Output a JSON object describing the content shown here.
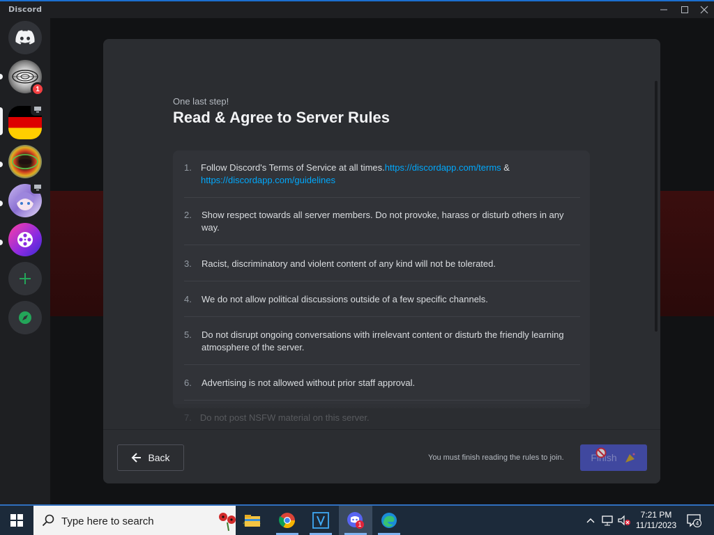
{
  "window": {
    "title": "Discord",
    "minimize": "—",
    "maximize": "☐",
    "close": "✕"
  },
  "sidebar": {
    "items": [
      {
        "name": "home",
        "icon": "discord-logo-icon"
      },
      {
        "name": "server-web",
        "badge": "1"
      },
      {
        "name": "server-germany",
        "selected": true
      },
      {
        "name": "server-colorful"
      },
      {
        "name": "server-anime"
      },
      {
        "name": "server-video"
      },
      {
        "name": "add-server",
        "icon": "plus-icon"
      },
      {
        "name": "explore",
        "icon": "compass-icon"
      }
    ]
  },
  "modal": {
    "eyebrow": "One last step!",
    "title": "Read & Agree to Server Rules",
    "rules": [
      {
        "num": "1.",
        "text": "Follow Discord's Terms of Service at all times.",
        "link1": "https://discordapp.com/terms",
        "joiner": " & ",
        "link2": "https://discordapp.com/guidelines"
      },
      {
        "num": "2.",
        "text": "Show respect towards all server members. Do not provoke, harass or disturb others in any way."
      },
      {
        "num": "3.",
        "text": "Racist, discriminatory and violent content of any kind will not be tolerated."
      },
      {
        "num": "4.",
        "text": "We do not allow political discussions outside of a few specific channels."
      },
      {
        "num": "5.",
        "text": "Do not disrupt ongoing conversations with irrelevant content or disturb the friendly learning atmosphere of the server."
      },
      {
        "num": "6.",
        "text": "Advertising is not allowed without prior staff approval."
      },
      {
        "num": "7.",
        "text": "Do not post NSFW material on this server."
      }
    ],
    "footer": {
      "back_label": "Back",
      "hint": "You must finish reading the rules to join.",
      "finish_label": "Finish"
    }
  },
  "taskbar": {
    "search_placeholder": "Type here to search",
    "apps": [
      "file-explorer",
      "chrome",
      "v-app",
      "discord",
      "edge"
    ],
    "discord_badge": "1",
    "time": "7:21 PM",
    "date": "11/11/2023",
    "notifications": "4"
  },
  "colors": {
    "blurple": "#5865f2",
    "link": "#00a8fc",
    "modal_bg": "#2b2d31"
  }
}
